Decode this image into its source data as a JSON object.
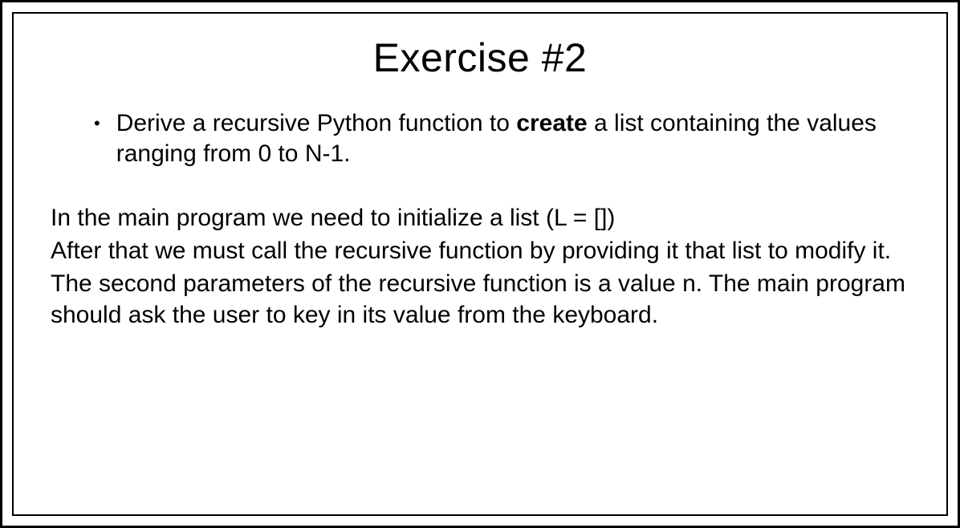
{
  "title": "Exercise #2",
  "bullet": {
    "part1": "Derive a recursive Python function to ",
    "bold": "create",
    "part2": " a list containing the values ranging from 0 to N-1."
  },
  "body": {
    "line1": "In the main program we need to initialize a list (L = [])",
    "line2": "After that we must call the recursive function by providing it that list to modify it.",
    "line3": "The second parameters of the recursive function is a value n.  The main program should ask the user to key in its value from the keyboard."
  }
}
